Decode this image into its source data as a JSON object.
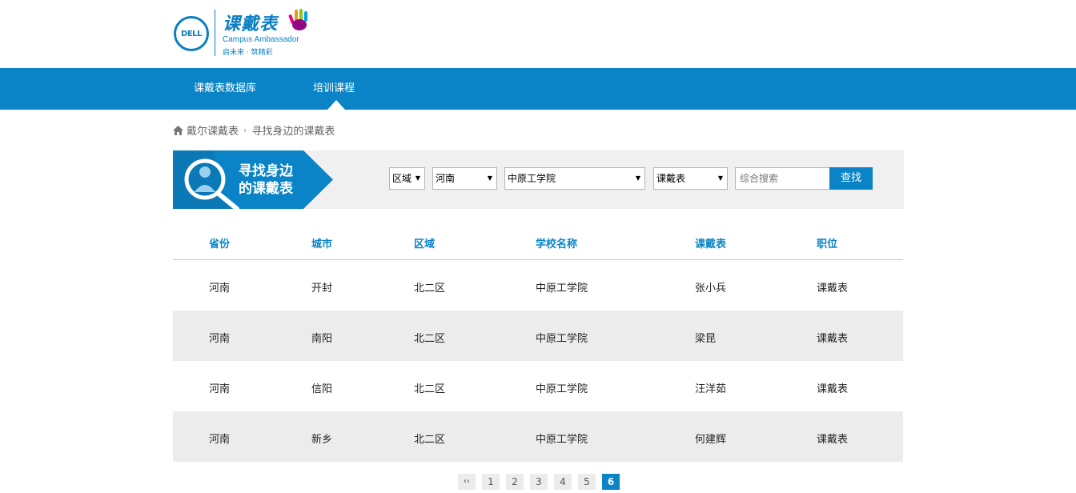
{
  "brand": {
    "dell": "DELL",
    "title": "课戴表",
    "subtitle": "Campus Ambassador",
    "slogan": "启未来 · 筑精彩"
  },
  "nav": {
    "items": [
      {
        "label": "课戴表数据库"
      },
      {
        "label": "培训课程"
      }
    ]
  },
  "breadcrumb": {
    "home": "戴尔课戴表",
    "current": "寻找身边的课戴表"
  },
  "search": {
    "banner_line1": "寻找身边",
    "banner_line2": "的课戴表",
    "region": "区域",
    "province": "河南",
    "school": "中原工学院",
    "role": "课戴表",
    "placeholder": "综合搜索",
    "button": "查找"
  },
  "table": {
    "headers": [
      "省份",
      "城市",
      "区域",
      "学校名称",
      "课戴表",
      "职位"
    ],
    "rows": [
      [
        "河南",
        "开封",
        "北二区",
        "中原工学院",
        "张小兵",
        "课戴表"
      ],
      [
        "河南",
        "南阳",
        "北二区",
        "中原工学院",
        "梁昆",
        "课戴表"
      ],
      [
        "河南",
        "信阳",
        "北二区",
        "中原工学院",
        "汪洋茹",
        "课戴表"
      ],
      [
        "河南",
        "新乡",
        "北二区",
        "中原工学院",
        "何建辉",
        "课戴表"
      ]
    ]
  },
  "pagination": {
    "prev": "‹‹",
    "pages": [
      "1",
      "2",
      "3",
      "4",
      "5",
      "6"
    ],
    "current": "6"
  },
  "colors": {
    "accent": "#0a84c6",
    "row_alt": "#ececec"
  }
}
